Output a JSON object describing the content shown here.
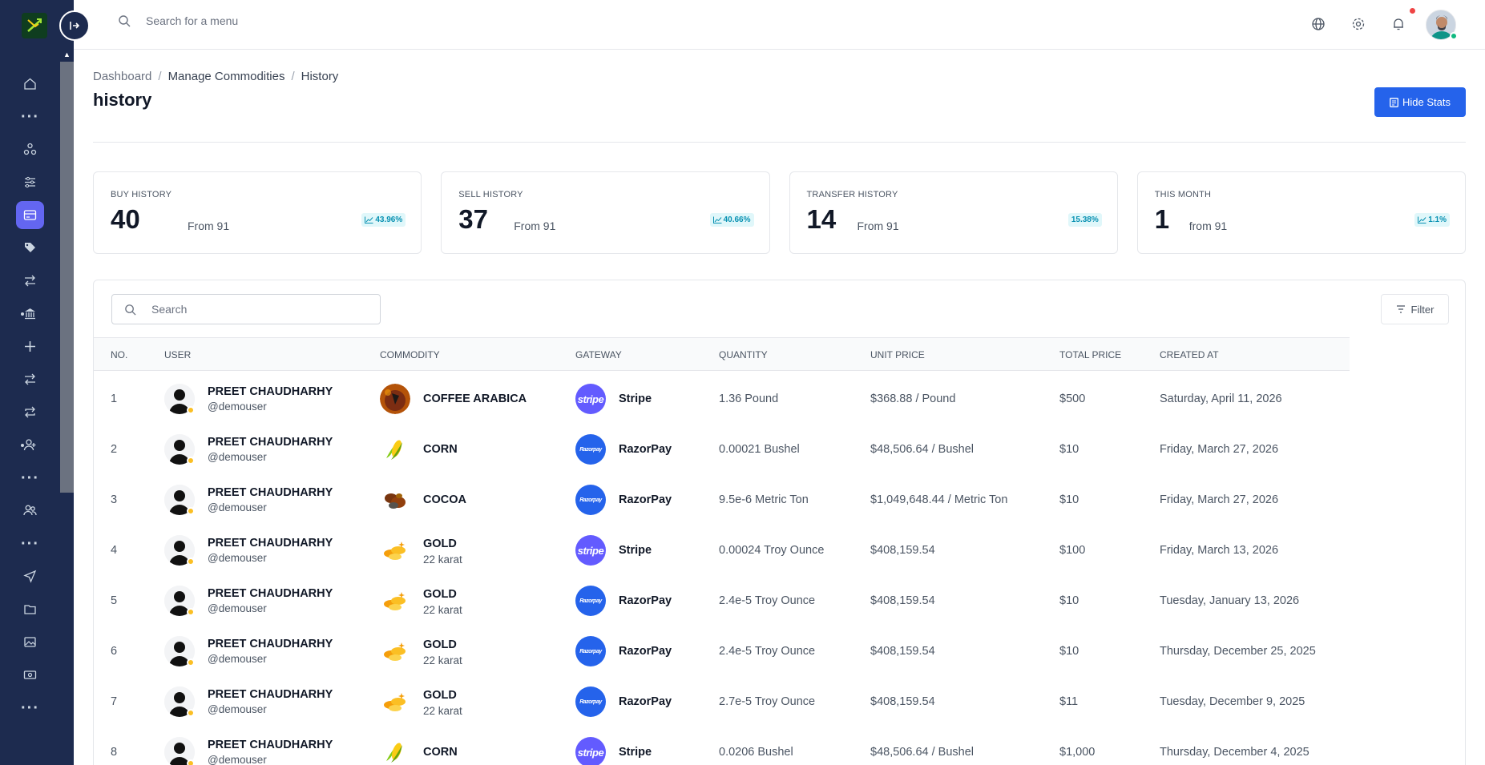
{
  "topbar": {
    "search_placeholder": "Search for a menu",
    "icons": [
      "globe-icon",
      "gear-icon",
      "bell-icon"
    ]
  },
  "breadcrumb": {
    "items": [
      "Dashboard",
      "Manage Commodities",
      "History"
    ],
    "separator": "/"
  },
  "page": {
    "title": "history",
    "hide_stats_label": "Hide Stats"
  },
  "stats": [
    {
      "label": "BUY HISTORY",
      "value": "40",
      "sub": "From 91",
      "badge": "43.96%",
      "badge_icon": "chart-line-icon"
    },
    {
      "label": "SELL HISTORY",
      "value": "37",
      "sub": "From 91",
      "badge": "40.66%",
      "badge_icon": "chart-area-icon"
    },
    {
      "label": "TRANSFER HISTORY",
      "value": "14",
      "sub": "From 91",
      "badge": "15.38%",
      "badge_icon": ""
    },
    {
      "label": "THIS MONTH",
      "value": "1",
      "sub": "from 91",
      "badge": "1.1%",
      "badge_icon": "chart-line-icon"
    }
  ],
  "table": {
    "search_placeholder": "Search",
    "filter_label": "Filter",
    "columns": [
      "NO.",
      "USER",
      "COMMODITY",
      "GATEWAY",
      "QUANTITY",
      "UNIT PRICE",
      "TOTAL PRICE",
      "CREATED AT"
    ],
    "rows": [
      {
        "no": "1",
        "user": "PREET CHAUDHARHY",
        "handle": "@demouser",
        "commodity": "COFFEE ARABICA",
        "commodity_sub": "",
        "commodity_icon": "coffee",
        "gateway": "Stripe",
        "quantity": "1.36 Pound",
        "unit_price": "$368.88 / Pound",
        "total": "$500",
        "created": "Saturday, April 11, 2026"
      },
      {
        "no": "2",
        "user": "PREET CHAUDHARHY",
        "handle": "@demouser",
        "commodity": "CORN",
        "commodity_sub": "",
        "commodity_icon": "corn",
        "gateway": "RazorPay",
        "quantity": "0.00021 Bushel",
        "unit_price": "$48,506.64 / Bushel",
        "total": "$10",
        "created": "Friday, March 27, 2026"
      },
      {
        "no": "3",
        "user": "PREET CHAUDHARHY",
        "handle": "@demouser",
        "commodity": "COCOA",
        "commodity_sub": "",
        "commodity_icon": "cocoa",
        "gateway": "RazorPay",
        "quantity": "9.5e-6 Metric Ton",
        "unit_price": "$1,049,648.44 / Metric Ton",
        "total": "$10",
        "created": "Friday, March 27, 2026"
      },
      {
        "no": "4",
        "user": "PREET CHAUDHARHY",
        "handle": "@demouser",
        "commodity": "GOLD",
        "commodity_sub": "22 karat",
        "commodity_icon": "gold",
        "gateway": "Stripe",
        "quantity": "0.00024 Troy Ounce",
        "unit_price": "$408,159.54",
        "total": "$100",
        "created": "Friday, March 13, 2026"
      },
      {
        "no": "5",
        "user": "PREET CHAUDHARHY",
        "handle": "@demouser",
        "commodity": "GOLD",
        "commodity_sub": "22 karat",
        "commodity_icon": "gold",
        "gateway": "RazorPay",
        "quantity": "2.4e-5 Troy Ounce",
        "unit_price": "$408,159.54",
        "total": "$10",
        "created": "Tuesday, January 13, 2026"
      },
      {
        "no": "6",
        "user": "PREET CHAUDHARHY",
        "handle": "@demouser",
        "commodity": "GOLD",
        "commodity_sub": "22 karat",
        "commodity_icon": "gold",
        "gateway": "RazorPay",
        "quantity": "2.4e-5 Troy Ounce",
        "unit_price": "$408,159.54",
        "total": "$10",
        "created": "Thursday, December 25, 2025"
      },
      {
        "no": "7",
        "user": "PREET CHAUDHARHY",
        "handle": "@demouser",
        "commodity": "GOLD",
        "commodity_sub": "22 karat",
        "commodity_icon": "gold",
        "gateway": "RazorPay",
        "quantity": "2.7e-5 Troy Ounce",
        "unit_price": "$408,159.54",
        "total": "$11",
        "created": "Tuesday, December 9, 2025"
      },
      {
        "no": "8",
        "user": "PREET CHAUDHARHY",
        "handle": "@demouser",
        "commodity": "CORN",
        "commodity_sub": "",
        "commodity_icon": "corn",
        "gateway": "Stripe",
        "quantity": "0.0206 Bushel",
        "unit_price": "$48,506.64 / Bushel",
        "total": "$1,000",
        "created": "Thursday, December 4, 2025"
      }
    ]
  },
  "sidebar": {
    "items": [
      "home-icon",
      "more-dots-icon",
      "nodes-icon",
      "sliders-icon",
      "card-icon",
      "tags-icon",
      "transfer-icon",
      "bank-icon",
      "plus-icon",
      "exchange-icon",
      "repeat-icon",
      "user-plus-icon",
      "more-dots-icon",
      "users-icon",
      "more-dots-icon",
      "send-icon",
      "folder-icon",
      "image-icon",
      "cash-icon",
      "more-dots-icon"
    ],
    "active_index": 4
  },
  "colors": {
    "sidebar_bg": "#1d2b4f",
    "accent": "#2563eb",
    "active_nav": "#6366f1",
    "badge_text": "#0891b2",
    "stripe": "#635bff",
    "razorpay": "#2563eb"
  }
}
